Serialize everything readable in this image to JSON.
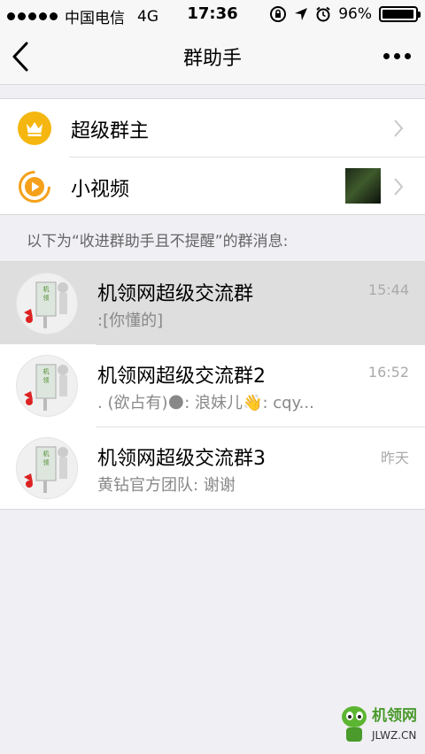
{
  "status_bar": {
    "carrier": "中国电信",
    "network": "4G",
    "time": "17:36",
    "battery_text": "96%",
    "battery_level": 0.96
  },
  "nav": {
    "title": "群助手",
    "back_icon": "chevron-left-icon",
    "more_icon": "ellipsis-icon"
  },
  "top_items": [
    {
      "label": "超级群主",
      "icon": "crown-icon",
      "color": "#f5b70f"
    },
    {
      "label": "小视频",
      "icon": "play-icon",
      "color": "#f5a01a"
    }
  ],
  "notice": "以下为“收进群助手且不提醒”的群消息:",
  "chats": [
    {
      "name": "机领网超级交流群",
      "time": "15:44",
      "preview": ":[你懂的]"
    },
    {
      "name": "机领网超级交流群2",
      "time": "16:52",
      "preview": ".        (欲占有)🌑: 浪妹儿👋: cqy..."
    },
    {
      "name": "机领网超级交流群3",
      "time": "昨天",
      "preview": "黄钻官方团队: 谢谢"
    }
  ],
  "watermark": {
    "brand": "机领网",
    "url": "JLWZ.CN"
  }
}
